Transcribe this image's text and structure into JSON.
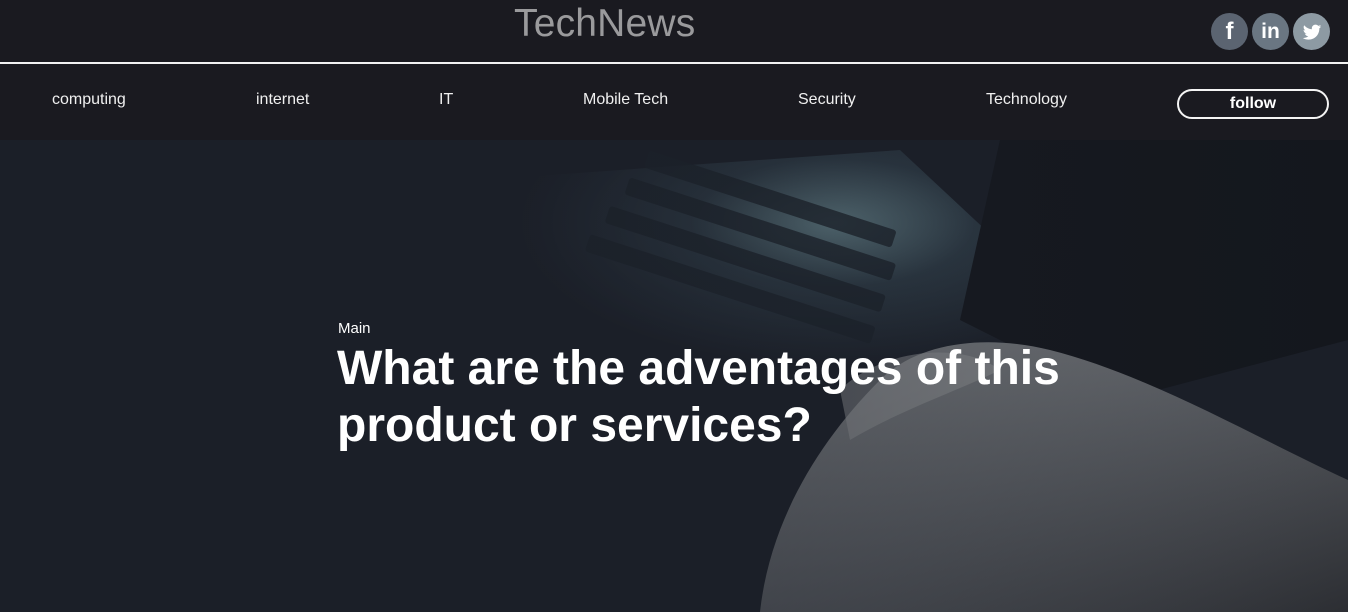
{
  "header": {
    "logo_text": "TechNews",
    "social": [
      {
        "name": "facebook",
        "glyph": "f",
        "color": "#5b6471"
      },
      {
        "name": "linkedin",
        "glyph": "in",
        "color": "#6a7682"
      },
      {
        "name": "twitter",
        "glyph": "",
        "color": "#8d9aa3"
      }
    ]
  },
  "nav": {
    "items": [
      "computing",
      "internet",
      "IT",
      "Mobile Tech",
      "Security",
      "Technology"
    ],
    "follow_label": "follow"
  },
  "hero": {
    "category": "Main",
    "title": "What are the adventages of this product or services?"
  },
  "colors": {
    "background": "#1a1a20",
    "logo": "#9a9a9c",
    "text": "#ffffff"
  }
}
